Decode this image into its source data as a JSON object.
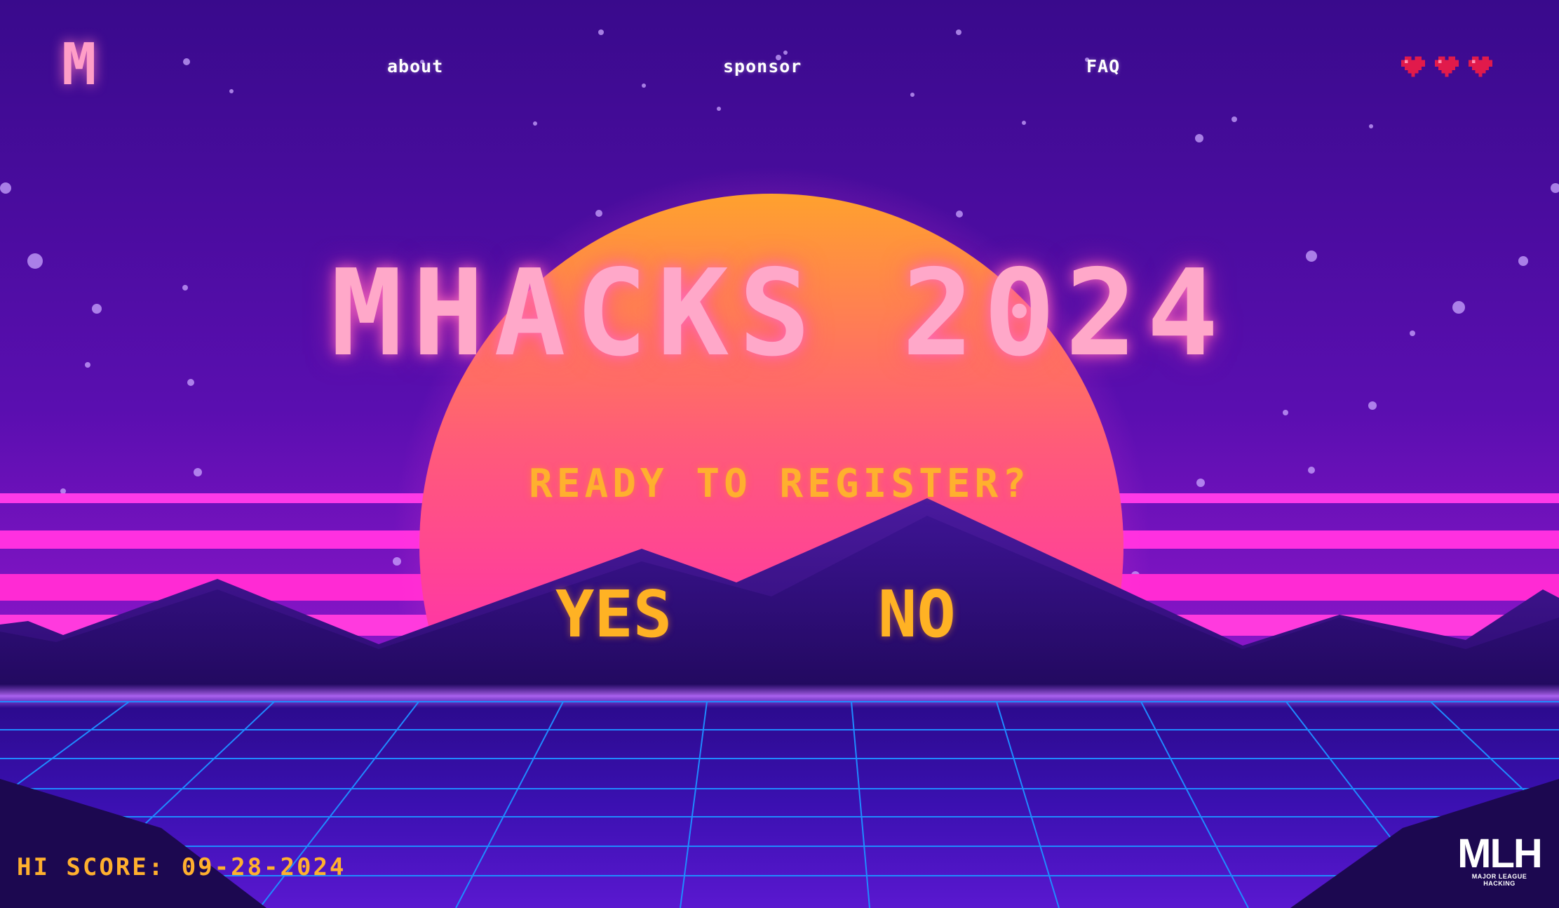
{
  "nav": {
    "logo_letter": "M",
    "links": [
      {
        "label": "about"
      },
      {
        "label": "sponsor"
      },
      {
        "label": "FAQ"
      }
    ],
    "lives": [
      {
        "icon": "pixel-heart-icon"
      },
      {
        "icon": "pixel-heart-icon"
      },
      {
        "icon": "pixel-heart-icon"
      }
    ]
  },
  "hero": {
    "title": "MHACKS 2024",
    "prompt": "READY TO REGISTER?",
    "yes_label": "YES",
    "no_label": "NO"
  },
  "footer": {
    "hi_score": "HI SCORE: 09-28-2024",
    "mlh_mark": "MLH",
    "mlh_sub": "MAJOR LEAGUE HACKING"
  },
  "colors": {
    "sky_top": "#3a0a8e",
    "sky_bottom": "#7a10c4",
    "sun_top": "#ffa030",
    "sun_bottom": "#ff2ab0",
    "title_pink": "#ffa8c9",
    "accent_yellow": "#ffb02e",
    "grid_blue": "#1f8bff",
    "heart_red": "#e11a4b"
  }
}
